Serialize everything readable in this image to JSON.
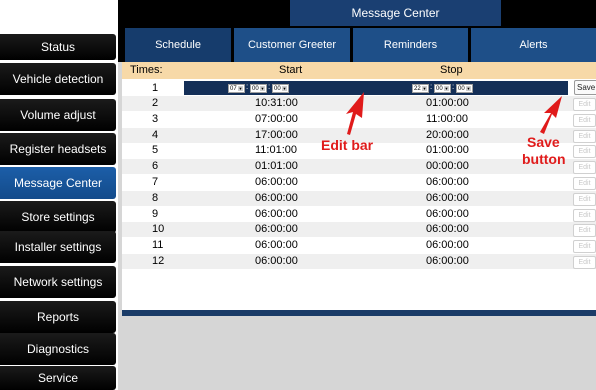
{
  "sidebar": {
    "items": [
      {
        "label": "Status"
      },
      {
        "label": "Vehicle detection"
      },
      {
        "label": "Volume adjust"
      },
      {
        "label": "Register headsets"
      },
      {
        "label": "Message Center",
        "active": true
      },
      {
        "label": "Store settings"
      },
      {
        "label": "Installer settings"
      },
      {
        "label": "Network settings"
      },
      {
        "label": "Reports"
      },
      {
        "label": "Diagnostics"
      },
      {
        "label": "Service"
      }
    ]
  },
  "header": {
    "title": "Message Center"
  },
  "tabs": [
    {
      "label": "Schedule",
      "active": true
    },
    {
      "label": "Customer Greeter"
    },
    {
      "label": "Reminders"
    },
    {
      "label": "Alerts"
    }
  ],
  "table": {
    "headers": {
      "times": "Times:",
      "start": "Start",
      "stop": "Stop"
    },
    "edit_row": {
      "index": "1",
      "start": {
        "hh": "07",
        "mm": "00",
        "ss": "00"
      },
      "stop": {
        "hh": "22",
        "mm": "00",
        "ss": "00"
      },
      "save_label": "Save"
    },
    "rows": [
      {
        "index": "2",
        "start": "10:31:00",
        "stop": "01:00:00",
        "edit": "Edit"
      },
      {
        "index": "3",
        "start": "07:00:00",
        "stop": "11:00:00",
        "edit": "Edit"
      },
      {
        "index": "4",
        "start": "17:00:00",
        "stop": "20:00:00",
        "edit": "Edit"
      },
      {
        "index": "5",
        "start": "11:01:00",
        "stop": "01:00:00",
        "edit": "Edit"
      },
      {
        "index": "6",
        "start": "01:01:00",
        "stop": "00:00:00",
        "edit": "Edit"
      },
      {
        "index": "7",
        "start": "06:00:00",
        "stop": "06:00:00",
        "edit": "Edit"
      },
      {
        "index": "8",
        "start": "06:00:00",
        "stop": "06:00:00",
        "edit": "Edit"
      },
      {
        "index": "9",
        "start": "06:00:00",
        "stop": "06:00:00",
        "edit": "Edit"
      },
      {
        "index": "10",
        "start": "06:00:00",
        "stop": "06:00:00",
        "edit": "Edit"
      },
      {
        "index": "11",
        "start": "06:00:00",
        "stop": "06:00:00",
        "edit": "Edit"
      },
      {
        "index": "12",
        "start": "06:00:00",
        "stop": "06:00:00",
        "edit": "Edit"
      }
    ]
  },
  "annotations": {
    "edit_bar": "Edit bar",
    "save_button_line1": "Save",
    "save_button_line2": "button"
  },
  "colors": {
    "accent": "#1e4f88",
    "active_nav": "#1c5ea8",
    "header_band": "#f7d9a8",
    "annotation": "#e01b1b"
  }
}
